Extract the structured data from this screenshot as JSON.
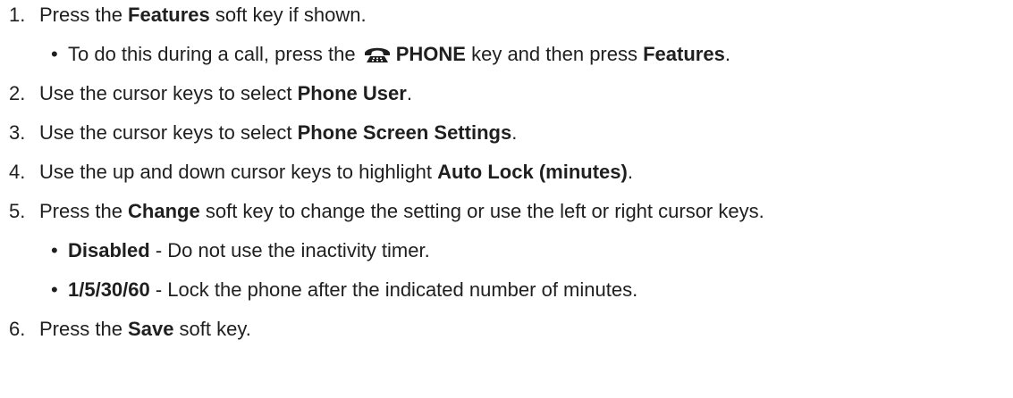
{
  "steps": [
    {
      "number": "1.",
      "parts": [
        "Press the ",
        "Features",
        " soft key if shown."
      ],
      "sub": [
        {
          "bullet": "•",
          "parts": [
            "To do this during a call, press the ",
            "PHONE",
            " key and then press ",
            "Features",
            "."
          ],
          "icon": "phone-icon"
        }
      ]
    },
    {
      "number": "2.",
      "parts": [
        "Use the cursor keys to select ",
        "Phone User",
        "."
      ]
    },
    {
      "number": "3.",
      "parts": [
        "Use the cursor keys to select ",
        "Phone Screen Settings",
        "."
      ]
    },
    {
      "number": "4.",
      "parts": [
        "Use the up and down cursor keys to highlight ",
        "Auto Lock (minutes)",
        "."
      ]
    },
    {
      "number": "5.",
      "parts": [
        "Press the ",
        "Change",
        " soft key to change the setting or use the left or right cursor keys."
      ],
      "sub": [
        {
          "bullet": "•",
          "parts": [
            "Disabled",
            " - Do not use the inactivity timer."
          ]
        },
        {
          "bullet": "•",
          "parts": [
            "1/5/30/60",
            " - Lock the phone after the indicated number of minutes."
          ]
        }
      ]
    },
    {
      "number": "6.",
      "parts": [
        "Press the ",
        "Save",
        " soft key."
      ]
    }
  ]
}
